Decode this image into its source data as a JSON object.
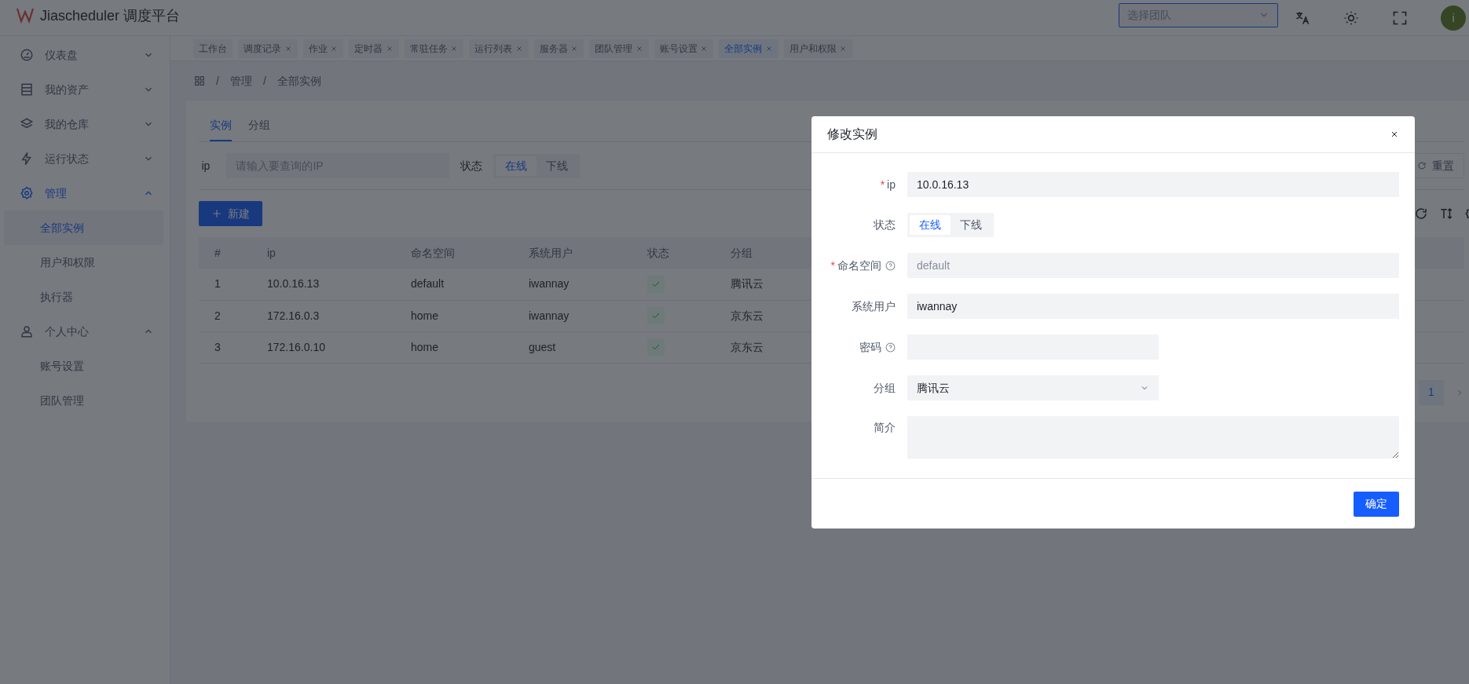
{
  "header": {
    "title": "Jiascheduler 调度平台",
    "team_select": {
      "placeholder": "选择团队"
    },
    "avatar": "i"
  },
  "sidebar": {
    "items": [
      {
        "label": "仪表盘",
        "selected": false,
        "expanded": false
      },
      {
        "label": "我的资产",
        "selected": false,
        "expanded": false
      },
      {
        "label": "我的仓库",
        "selected": false,
        "expanded": false
      },
      {
        "label": "运行状态",
        "selected": false,
        "expanded": false
      },
      {
        "label": "管理",
        "selected": true,
        "expanded": true,
        "children": [
          {
            "label": "全部实例",
            "selected": true
          },
          {
            "label": "用户和权限",
            "selected": false
          },
          {
            "label": "执行器",
            "selected": false
          }
        ]
      },
      {
        "label": "个人中心",
        "selected": false,
        "expanded": true,
        "children": [
          {
            "label": "账号设置",
            "selected": false
          },
          {
            "label": "团队管理",
            "selected": false
          }
        ]
      }
    ]
  },
  "tabs": [
    {
      "label": "工作台",
      "closable": false,
      "selected": false
    },
    {
      "label": "调度记录",
      "closable": true,
      "selected": false
    },
    {
      "label": "作业",
      "closable": true,
      "selected": false
    },
    {
      "label": "定时器",
      "closable": true,
      "selected": false
    },
    {
      "label": "常驻任务",
      "closable": true,
      "selected": false
    },
    {
      "label": "运行列表",
      "closable": true,
      "selected": false
    },
    {
      "label": "服务器",
      "closable": true,
      "selected": false
    },
    {
      "label": "团队管理",
      "closable": true,
      "selected": false
    },
    {
      "label": "账号设置",
      "closable": true,
      "selected": false
    },
    {
      "label": "全部实例",
      "closable": true,
      "selected": true
    },
    {
      "label": "用户和权限",
      "closable": true,
      "selected": false
    }
  ],
  "breadcrumb": [
    {
      "separator": "/",
      "label": "管理"
    },
    {
      "separator": "/",
      "label": "全部实例"
    }
  ],
  "card": {
    "tabs": [
      {
        "label": "实例",
        "selected": true
      },
      {
        "label": "分组",
        "selected": false
      }
    ],
    "filter": {
      "ip_label": "ip",
      "ip_placeholder": "请输入要查询的IP",
      "status_label": "状态",
      "status_options": [
        {
          "label": "在线",
          "selected": true
        },
        {
          "label": "下线",
          "selected": false
        }
      ],
      "reset_button": "重置"
    },
    "new_button": "新建",
    "table": {
      "columns": [
        "#",
        "ip",
        "命名空间",
        "系统用户",
        "状态",
        "分组"
      ],
      "rows": [
        {
          "index": "1",
          "ip": "10.0.16.13",
          "namespace": "default",
          "user": "iwannay",
          "online": true,
          "group": "腾讯云"
        },
        {
          "index": "2",
          "ip": "172.16.0.3",
          "namespace": "home",
          "user": "iwannay",
          "online": true,
          "group": "京东云"
        },
        {
          "index": "3",
          "ip": "172.16.0.10",
          "namespace": "home",
          "user": "guest",
          "online": true,
          "group": "京东云"
        }
      ]
    },
    "pagination": {
      "pages": [
        {
          "label": "1",
          "selected": true
        }
      ]
    }
  },
  "modal": {
    "title": "修改实例",
    "required_mark": "*",
    "fields": [
      {
        "kind": "text",
        "label": "ip",
        "required": true,
        "help": false,
        "value": "10.0.16.13"
      },
      {
        "kind": "segmented",
        "label": "状态",
        "required": false,
        "help": false,
        "options": [
          {
            "label": "在线",
            "selected": true
          },
          {
            "label": "下线",
            "selected": false
          }
        ]
      },
      {
        "kind": "text",
        "label": "命名空间",
        "required": true,
        "help": true,
        "placeholder": "default"
      },
      {
        "kind": "text",
        "label": "系统用户",
        "required": false,
        "help": false,
        "value": "iwannay"
      },
      {
        "kind": "password",
        "label": "密码",
        "required": false,
        "help": true
      },
      {
        "kind": "select",
        "label": "分组",
        "required": false,
        "help": false,
        "value": "腾讯云"
      },
      {
        "kind": "textarea",
        "label": "简介",
        "required": false,
        "help": false
      }
    ],
    "confirm_button": "确定"
  }
}
